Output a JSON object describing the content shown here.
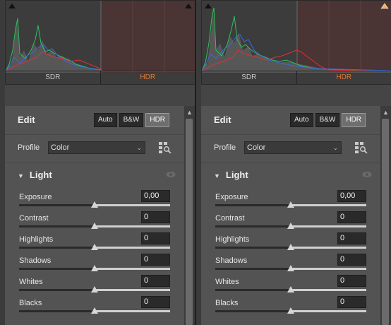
{
  "colors": {
    "hdr_label": "#e07a3a",
    "panel_bg": "#535353",
    "histogram_red": "#e0303a",
    "histogram_green": "#30c060",
    "histogram_blue": "#3a6ae0"
  },
  "panels": [
    {
      "histogram": {
        "left_label": "SDR",
        "right_label": "HDR",
        "left_clip_icon": "shadow-clip-icon",
        "right_clip_icon": "highlight-clip-icon",
        "highlight_clip_active": false
      },
      "edit": {
        "title": "Edit",
        "modes": [
          "Auto",
          "B&W",
          "HDR"
        ],
        "active_mode": "HDR",
        "profile_label": "Profile",
        "profile_value": "Color",
        "profile_browser_icon": "profile-browser-icon",
        "section_title": "Light",
        "sliders": [
          {
            "label": "Exposure",
            "value": "0,00"
          },
          {
            "label": "Contrast",
            "value": "0"
          },
          {
            "label": "Highlights",
            "value": "0"
          },
          {
            "label": "Shadows",
            "value": "0"
          },
          {
            "label": "Whites",
            "value": "0"
          },
          {
            "label": "Blacks",
            "value": "0"
          }
        ]
      }
    },
    {
      "histogram": {
        "left_label": "SDR",
        "right_label": "HDR",
        "left_clip_icon": "shadow-clip-icon",
        "right_clip_icon": "highlight-clip-icon",
        "highlight_clip_active": true
      },
      "edit": {
        "title": "Edit",
        "modes": [
          "Auto",
          "B&W",
          "HDR"
        ],
        "active_mode": "HDR",
        "profile_label": "Profile",
        "profile_value": "Color",
        "profile_browser_icon": "profile-browser-icon",
        "section_title": "Light",
        "sliders": [
          {
            "label": "Exposure",
            "value": "0,00"
          },
          {
            "label": "Contrast",
            "value": "0"
          },
          {
            "label": "Highlights",
            "value": "0"
          },
          {
            "label": "Shadows",
            "value": "0"
          },
          {
            "label": "Whites",
            "value": "0"
          },
          {
            "label": "Blacks",
            "value": "0"
          }
        ]
      }
    }
  ]
}
